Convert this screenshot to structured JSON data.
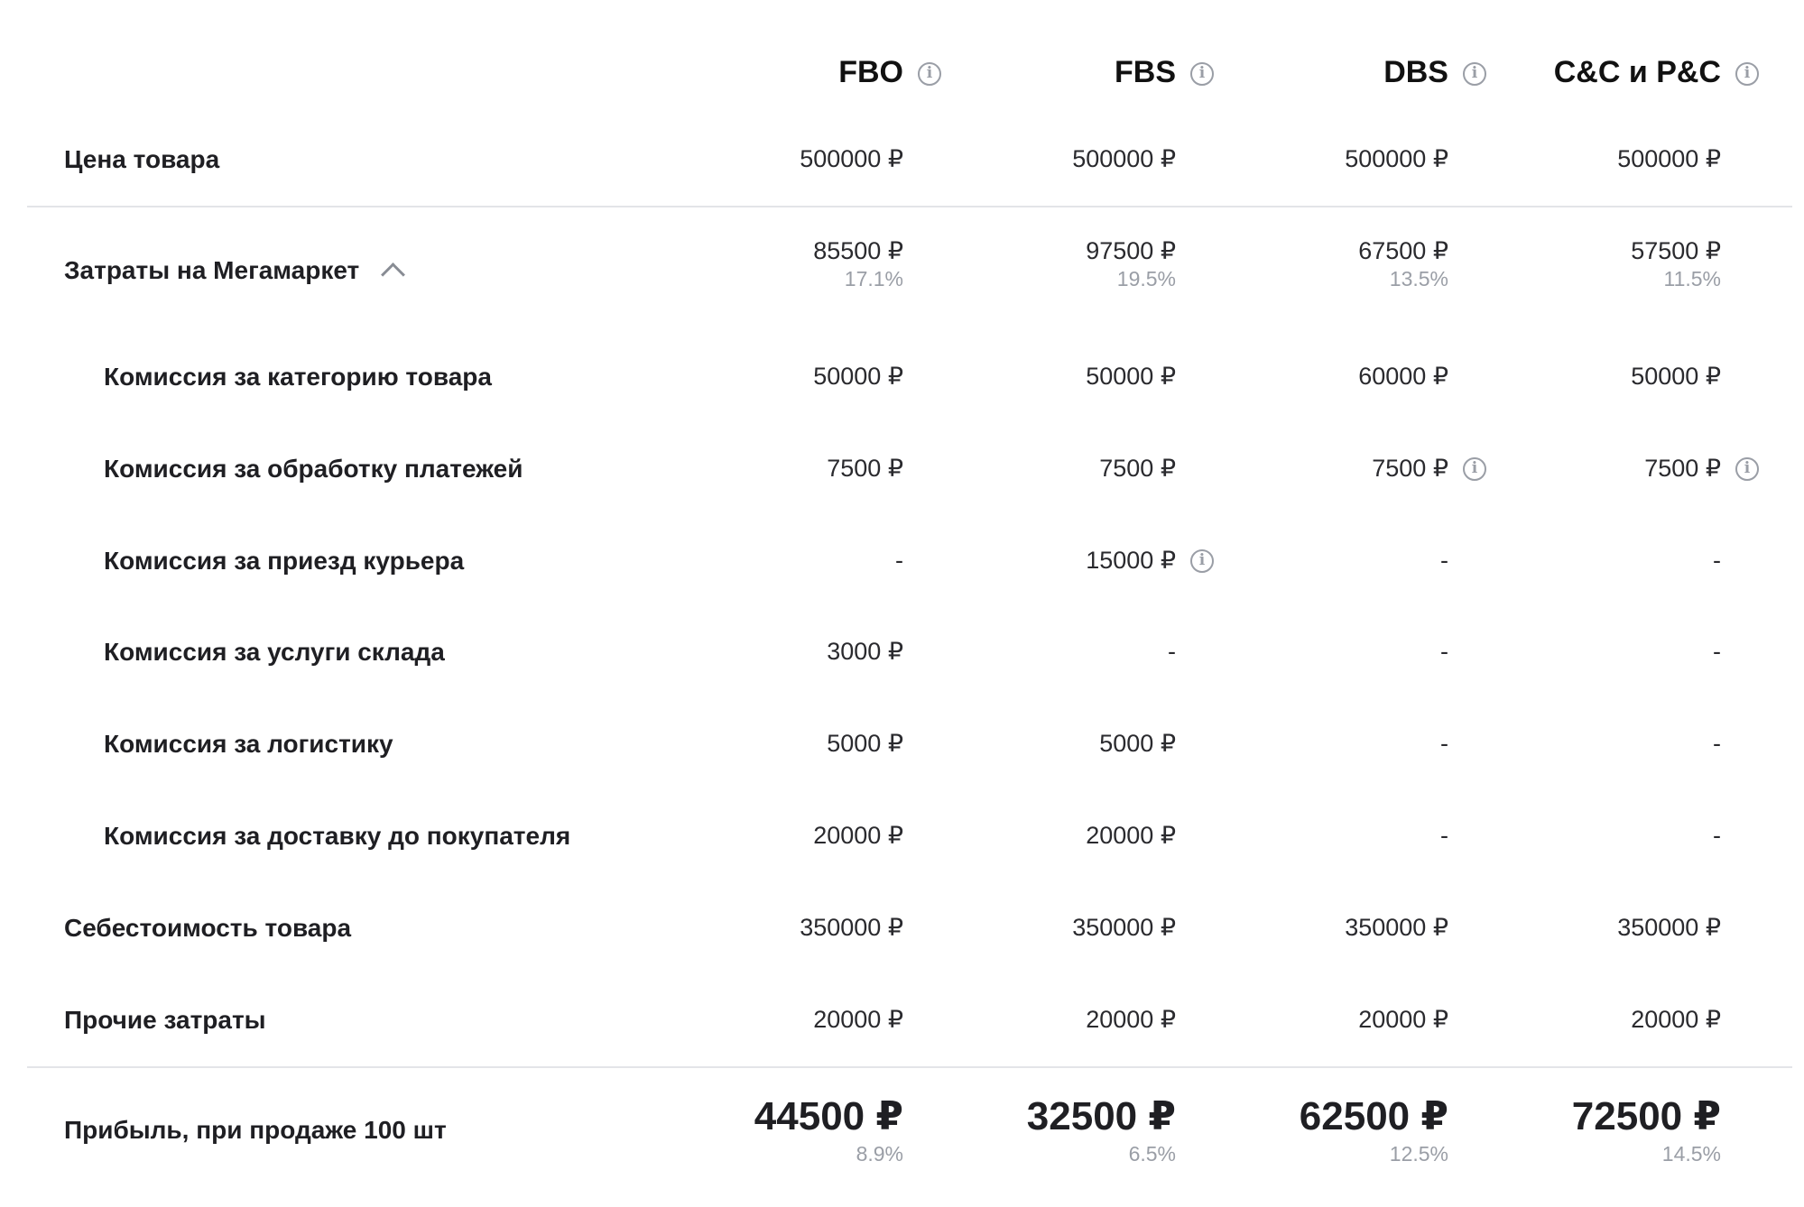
{
  "columns": [
    {
      "title": "FBO"
    },
    {
      "title": "FBS"
    },
    {
      "title": "DBS"
    },
    {
      "title": "C&C и P&C"
    }
  ],
  "rows": {
    "price": {
      "label": "Цена товара",
      "values": [
        "500000 ₽",
        "500000 ₽",
        "500000 ₽",
        "500000 ₽"
      ]
    },
    "costs": {
      "label": "Затраты на Мегамаркет",
      "values": [
        "85500 ₽",
        "97500 ₽",
        "67500 ₽",
        "57500 ₽"
      ],
      "percents": [
        "17.1%",
        "19.5%",
        "13.5%",
        "11.5%"
      ]
    },
    "category_fee": {
      "label": "Комиссия за категорию товара",
      "values": [
        "50000 ₽",
        "50000 ₽",
        "60000 ₽",
        "50000 ₽"
      ]
    },
    "payment_fee": {
      "label": "Комиссия за обработку платежей",
      "values": [
        "7500 ₽",
        "7500 ₽",
        "7500 ₽",
        "7500 ₽"
      ]
    },
    "courier_fee": {
      "label": "Комиссия за приезд курьера",
      "values": [
        "-",
        "15000 ₽",
        "-",
        "-"
      ]
    },
    "warehouse_fee": {
      "label": "Комиссия за услуги склада",
      "values": [
        "3000 ₽",
        "-",
        "-",
        "-"
      ]
    },
    "logistics_fee": {
      "label": "Комиссия за логистику",
      "values": [
        "5000 ₽",
        "5000 ₽",
        "-",
        "-"
      ]
    },
    "delivery_fee": {
      "label": "Комиссия за доставку до покупателя",
      "values": [
        "20000 ₽",
        "20000 ₽",
        "-",
        "-"
      ]
    },
    "cost_price": {
      "label": "Себестоимость товара",
      "values": [
        "350000 ₽",
        "350000 ₽",
        "350000 ₽",
        "350000 ₽"
      ]
    },
    "other_costs": {
      "label": "Прочие затраты",
      "values": [
        "20000 ₽",
        "20000 ₽",
        "20000 ₽",
        "20000 ₽"
      ]
    },
    "profit": {
      "label": "Прибыль, при продаже 100 шт",
      "values": [
        "44500 ₽",
        "32500 ₽",
        "62500 ₽",
        "72500 ₽"
      ],
      "percents": [
        "8.9%",
        "6.5%",
        "12.5%",
        "14.5%"
      ]
    }
  },
  "icons": {
    "info": "info-icon",
    "collapse": "chevron-up-icon"
  },
  "colors": {
    "text": "#1f1f23",
    "muted": "#9a9ea6",
    "divider": "#e3e4e8"
  }
}
